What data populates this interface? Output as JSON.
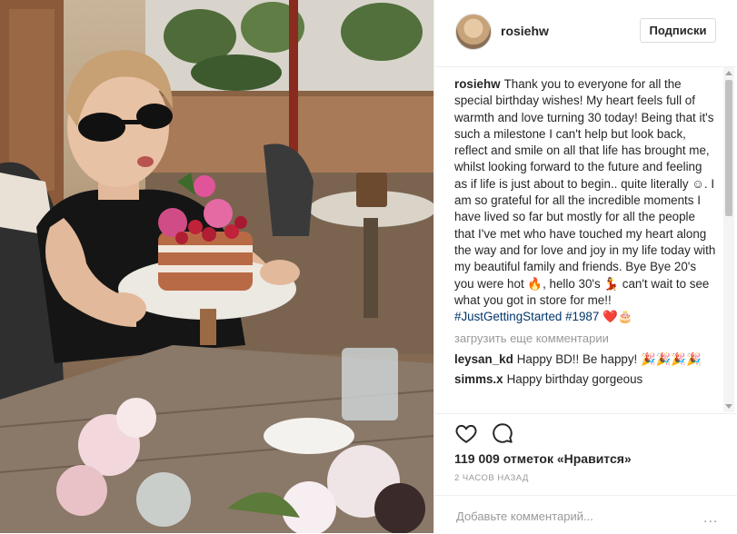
{
  "post": {
    "image_alt": "Woman in sunglasses holding a birthday cake"
  },
  "header": {
    "username": "rosiehw",
    "follow_label": "Подписки"
  },
  "caption": {
    "author": "rosiehw",
    "text": "Thank you to everyone for all the special birthday wishes! My heart feels full of warmth and love turning 30 today! Being that it's such a milestone I can't help but look back, reflect and smile on all that life has brought me, whilst looking forward to the future and feeling as if life is just about to begin.. quite literally ☺. I am so grateful for all the incredible moments I have lived so far but mostly for all the people that I've met who have touched my heart along the way and for love and joy in my life today with my beautiful family and friends. Bye Bye 20's you were hot 🔥, hello 30's 💃 can't wait to see what you got in store for me!!",
    "hashtags": "#JustGettingStarted #1987",
    "tail": "❤️🎂"
  },
  "load_more_label": "загрузить еще комментарии",
  "comments": [
    {
      "author": "leysan_kd",
      "text": "Happy BD!! Be happy! 🎉🎉🎉🎉"
    },
    {
      "author": "simms.x",
      "text": "Happy birthday gorgeous"
    }
  ],
  "likes_text": "119 009 отметок «Нравится»",
  "timestamp": "2 ЧАСОВ НАЗАД",
  "add_comment_placeholder": "Добавьте комментарий...",
  "more_label": "..."
}
